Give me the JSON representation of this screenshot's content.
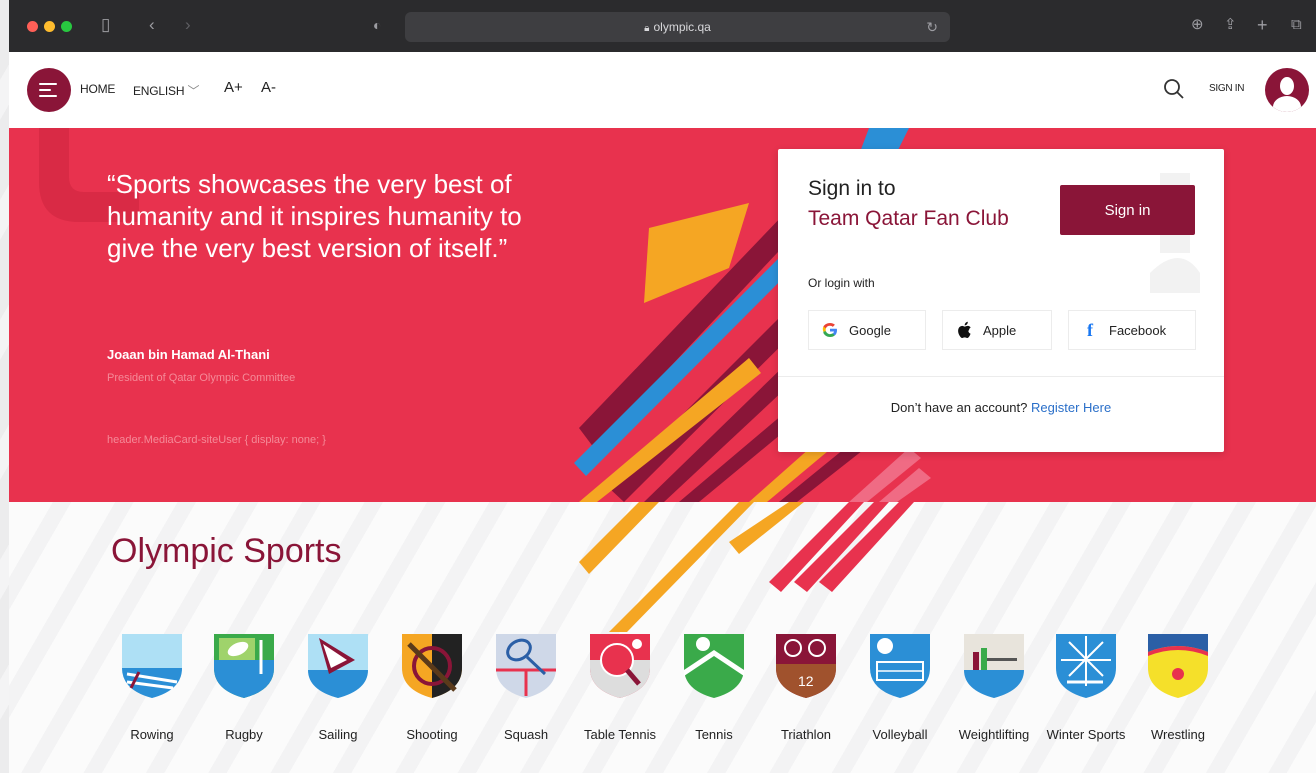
{
  "browser": {
    "url": "olympic.qa"
  },
  "header": {
    "home": "HOME",
    "language": "ENGLISH",
    "font_plus": "A+",
    "font_minus": "A-",
    "sign_in": "SIGN IN"
  },
  "hero": {
    "quote": "“Sports showcases the very best of humanity and it inspires humanity to give the very best version of itself.”",
    "author": "Joaan bin Hamad Al-Thani",
    "author_title": "President of Qatar Olympic Committee",
    "debug_text": "header.MediaCard-siteUser { display: none; }"
  },
  "signin_card": {
    "title_line1": "Sign in to",
    "title_line2": "Team Qatar Fan Club",
    "button": "Sign in",
    "or_login": "Or login with",
    "google": "Google",
    "apple": "Apple",
    "facebook": "Facebook",
    "no_account": "Don’t have an account?",
    "register": "Register Here"
  },
  "colors": {
    "maroon": "#8a1538",
    "hero_red": "#e8324e",
    "link_blue": "#2a6fc9"
  },
  "sports": {
    "title": "Olympic Sports",
    "items": [
      {
        "label": "Rowing",
        "icon": "rowing-icon"
      },
      {
        "label": "Rugby",
        "icon": "rugby-icon"
      },
      {
        "label": "Sailing",
        "icon": "sailing-icon"
      },
      {
        "label": "Shooting",
        "icon": "shooting-icon"
      },
      {
        "label": "Squash",
        "icon": "squash-icon"
      },
      {
        "label": "Table Tennis",
        "icon": "table-tennis-icon"
      },
      {
        "label": "Tennis",
        "icon": "tennis-icon"
      },
      {
        "label": "Triathlon",
        "icon": "triathlon-icon"
      },
      {
        "label": "Volleyball",
        "icon": "volleyball-icon"
      },
      {
        "label": "Weightlifting",
        "icon": "weightlifting-icon"
      },
      {
        "label": "Winter Sports",
        "icon": "winter-sports-icon"
      },
      {
        "label": "Wrestling",
        "icon": "wrestling-icon"
      }
    ]
  }
}
